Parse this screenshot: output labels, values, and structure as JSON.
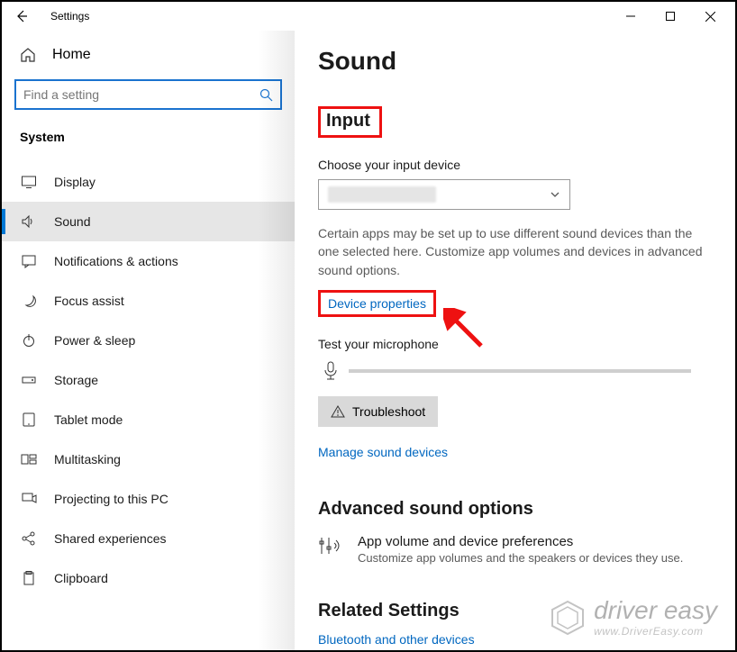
{
  "window": {
    "title": "Settings"
  },
  "sidebar": {
    "home_label": "Home",
    "search_placeholder": "Find a setting",
    "section_label": "System",
    "items": [
      {
        "label": "Display",
        "icon": "display-icon",
        "selected": false
      },
      {
        "label": "Sound",
        "icon": "sound-icon",
        "selected": true
      },
      {
        "label": "Notifications & actions",
        "icon": "notifications-icon",
        "selected": false
      },
      {
        "label": "Focus assist",
        "icon": "focus-icon",
        "selected": false
      },
      {
        "label": "Power & sleep",
        "icon": "power-icon",
        "selected": false
      },
      {
        "label": "Storage",
        "icon": "storage-icon",
        "selected": false
      },
      {
        "label": "Tablet mode",
        "icon": "tablet-icon",
        "selected": false
      },
      {
        "label": "Multitasking",
        "icon": "multitask-icon",
        "selected": false
      },
      {
        "label": "Projecting to this PC",
        "icon": "project-icon",
        "selected": false
      },
      {
        "label": "Shared experiences",
        "icon": "share-icon",
        "selected": false
      },
      {
        "label": "Clipboard",
        "icon": "clipboard-icon",
        "selected": false
      }
    ]
  },
  "main": {
    "title": "Sound",
    "input_section": "Input",
    "choose_label": "Choose your input device",
    "dropdown_value": "",
    "note": "Certain apps may be set up to use different sound devices than the one selected here. Customize app volumes and devices in advanced sound options.",
    "device_properties": "Device properties",
    "test_label": "Test your microphone",
    "troubleshoot": "Troubleshoot",
    "manage_link": "Manage sound devices",
    "advanced_heading": "Advanced sound options",
    "advanced_item_title": "App volume and device preferences",
    "advanced_item_sub": "Customize app volumes and the speakers or devices they use.",
    "related_heading": "Related Settings",
    "related_link": "Bluetooth and other devices"
  },
  "watermark": {
    "line1": "driver easy",
    "line2": "www.DriverEasy.com"
  },
  "annotations": {
    "highlight_color": "#e11"
  }
}
